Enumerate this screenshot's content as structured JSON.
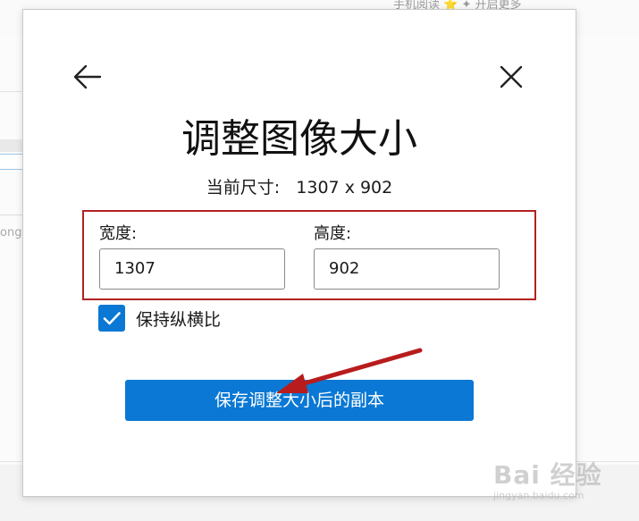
{
  "background": {
    "topbar_text": "手机阅读   ⭐  ✦ 开启更多",
    "side_text": "ong"
  },
  "watermark": {
    "main": "Bai 经验",
    "sub": "jingyan.baidu.com"
  },
  "dialog": {
    "title": "调整图像大小",
    "current_size_label": "当前尺寸:",
    "current_size_value": "1307 x 902",
    "width_label": "宽度:",
    "height_label": "高度:",
    "width_value": "1307",
    "height_value": "902",
    "keep_ratio_label": "保持纵横比",
    "keep_ratio_checked": true,
    "save_button_label": "保存调整大小后的副本",
    "back_icon": "back-arrow-icon",
    "close_icon": "close-icon"
  },
  "colors": {
    "accent": "#0a78d4",
    "highlight_border": "#b22222",
    "annotation_arrow": "#b81c1c"
  }
}
